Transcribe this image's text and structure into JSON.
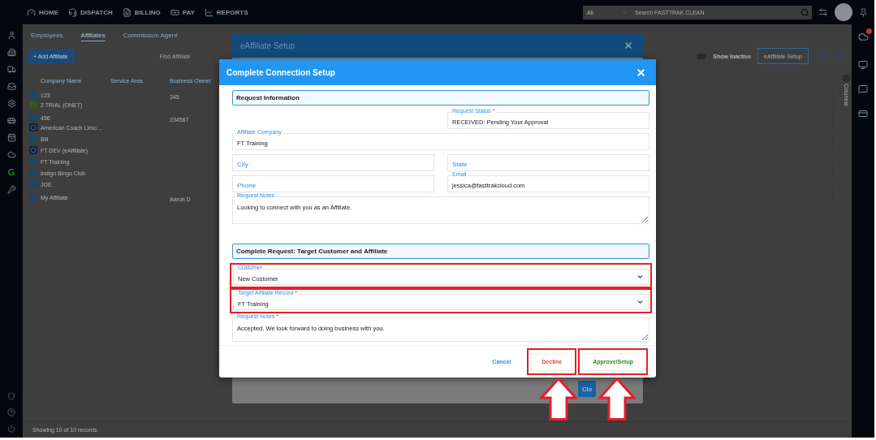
{
  "top_nav": {
    "items": [
      {
        "label": "HOME",
        "kind": "home"
      },
      {
        "label": "DISPATCH",
        "kind": "dispatch"
      },
      {
        "label": "BILLING",
        "kind": "billing"
      },
      {
        "label": "PAY",
        "kind": "pay"
      },
      {
        "label": "REPORTS",
        "kind": "reports"
      }
    ],
    "search": {
      "scope": "All",
      "placeholder": "Search FASTTRAK CLEAN"
    }
  },
  "sidebar_logo": "G",
  "required_marker": "*",
  "tabs": [
    {
      "label": "Employees",
      "selected": false
    },
    {
      "label": "Affiliates",
      "selected": true
    },
    {
      "label": "Commission Agent",
      "selected": false
    }
  ],
  "toolbar": {
    "add_button": "+ Add Affiliate",
    "find_placeholder": "Find Affiliate",
    "show_inactive": {
      "label": "Show Inactive",
      "on": false
    },
    "setup_button": "eAffiliate Setup"
  },
  "table": {
    "columns": [
      "Company Name",
      "Service Area",
      "Business Owner"
    ],
    "rows": [
      {
        "company": "123",
        "owner": "345",
        "kind": "circle"
      },
      {
        "company": "2 TRIAL (ONET)",
        "kind": "cube"
      },
      {
        "company": "456",
        "owner": "234567",
        "kind": "circle"
      },
      {
        "company": "American Coach Limo...",
        "kind": "square"
      },
      {
        "company": "Bill",
        "kind": "circle"
      },
      {
        "company": "FT DEV (eAffiliate)",
        "kind": "square"
      },
      {
        "company": "FT Training",
        "kind": "circle"
      },
      {
        "company": "Indigo Bingo Club",
        "kind": "circle"
      },
      {
        "company": "JOE",
        "kind": "circle"
      },
      {
        "company": "My Affiliate",
        "owner": "Aaron D",
        "kind": "circle"
      }
    ]
  },
  "columns_label": "Columns",
  "footer": "Showing 10 of 10 records.",
  "back_modal": {
    "title": "eAffiliate Setup",
    "close_button": "Clo"
  },
  "modal": {
    "title": "Complete Connection Setup",
    "info_section": {
      "title": "Request Information",
      "request_status": {
        "label": "Request Status",
        "value": "RECEIVED: Pending Your Approval",
        "required": true
      },
      "affiliate_company": {
        "label": "Affiliate Company",
        "value": "FT Training",
        "required": false
      },
      "city": {
        "placeholder": "City"
      },
      "state": {
        "placeholder": "State"
      },
      "phone": {
        "placeholder": "Phone"
      },
      "email": {
        "label": "Email",
        "value": "jessica@fasttrakcloud.com",
        "required": false
      },
      "request_notes": {
        "label": "Request Notes",
        "value": "Looking to connect with you as an Affiliate.",
        "required": false
      }
    },
    "complete_section": {
      "title": "Complete Request: Target Customer and Affiliate",
      "customer": {
        "label": "Customer",
        "value": "New Customer",
        "required": false
      },
      "target_affiliate_record": {
        "label": "Target Affiliate Record",
        "value": "FT Training",
        "required": true
      },
      "request_notes": {
        "label": "Request Notes",
        "value": "Accepted. We look forward to doing business with you.",
        "required": true
      }
    },
    "buttons": {
      "cancel": "Cancel",
      "decline": "Decline",
      "approve": "Approve/Setup"
    }
  }
}
